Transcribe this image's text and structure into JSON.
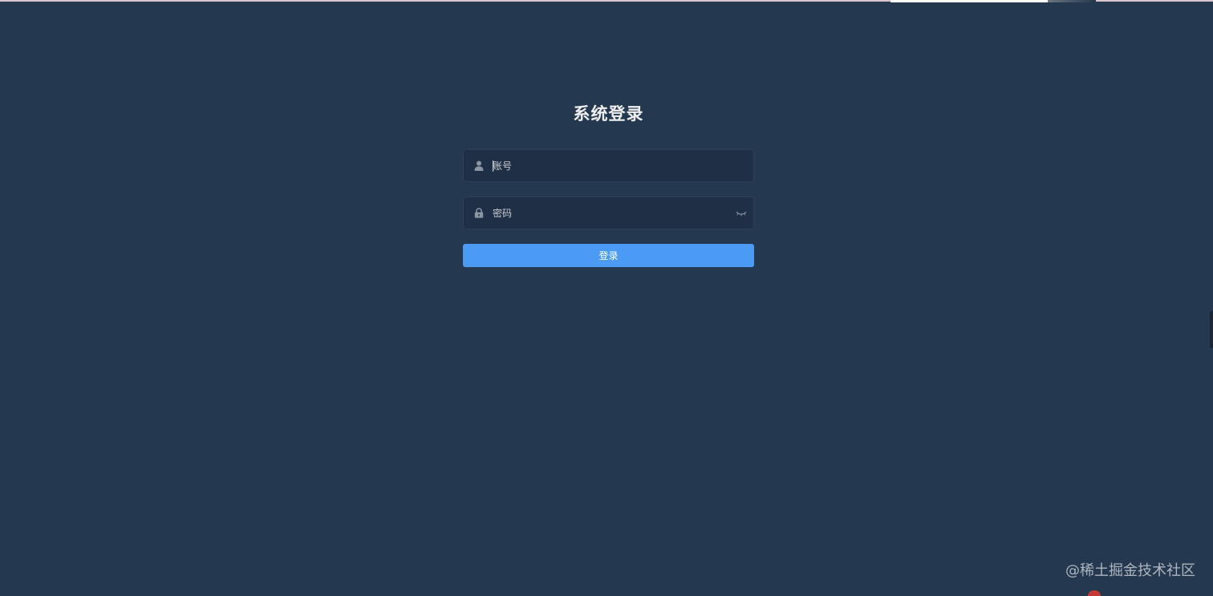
{
  "title": "系统登录",
  "account": {
    "placeholder": "账号",
    "value": "",
    "icon": "user-icon"
  },
  "password": {
    "placeholder": "密码",
    "value": "",
    "icon": "lock-icon",
    "toggle_icon": "eye-closed-icon"
  },
  "login_button": "登录",
  "watermark": "@稀土掘金技术社区",
  "colors": {
    "background": "#243850",
    "field": "#1f2f45",
    "accent": "#4b9bf5"
  }
}
